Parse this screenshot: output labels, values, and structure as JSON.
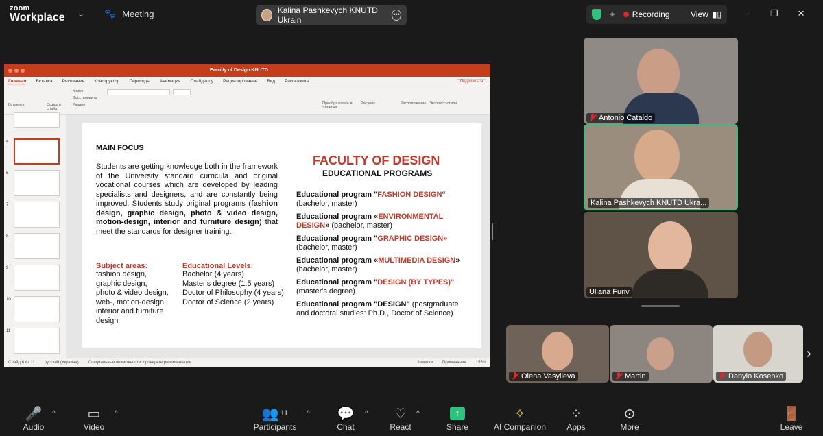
{
  "app": {
    "brand_small": "zoom",
    "brand_big": "Workplace",
    "meeting_label": "Meeting"
  },
  "share": {
    "presenter": "Kalina Pashkevych KNUTD Ukrain"
  },
  "status": {
    "recording": "Recording",
    "view": "View"
  },
  "ppt": {
    "title": "Faculty of Design KNUTD",
    "menu": [
      "Главная",
      "Вставка",
      "Рисование",
      "Конструктор",
      "Переходы",
      "Анимация",
      "Слайд-шоу",
      "Рецензирование",
      "Вид",
      "Расскажите"
    ],
    "share_btn": "Поделиться",
    "ribbon": {
      "paste": "Вставить",
      "new_slide": "Создать слайд",
      "layout": "Макет",
      "reset": "Восстановить",
      "section": "Раздел",
      "smartart": "Преобразовать в SmartArt",
      "picture": "Рисунок",
      "arrange": "Расположение",
      "styles": "Экспресс-стили"
    },
    "thumbs": [
      "5",
      "6",
      "7",
      "8",
      "9",
      "10",
      "11"
    ],
    "statusbar": {
      "slide": "Слайд 6 из 11",
      "lang": "русский (Украина)",
      "access": "Специальные возможности: проверьте рекомендации",
      "notes": "Заметки",
      "comments": "Примечания",
      "zoom": "155%"
    }
  },
  "slide": {
    "main_focus": "MAIN FOCUS",
    "para_a": "Students are getting knowledge both in the framework of the University standard curricula and original vocational courses which are developed by leading specialists and designers, and are constantly being improved. Students study original programs (",
    "para_bold": "fashion design, graphic design, photo & video design, motion-design, interior and furniture design",
    "para_b": ") that meet the standards for designer training.",
    "subject_title": "Subject areas:",
    "subjects": [
      "fashion design,",
      "graphic design,",
      "photo & video design,",
      "web-, motion-design,",
      "interior and furniture",
      "design"
    ],
    "levels_title": "Educational Levels:",
    "levels": [
      "Bachelor (4 years)",
      "Master's degree (1.5 years)",
      "Doctor of Philosophy (4 years)",
      "Doctor of Science (2 years)"
    ],
    "faculty": "FACULTY OF DESIGN",
    "edu_programs": "EDUCATIONAL PROGRAMS",
    "progs": [
      {
        "pre": "Educational program \"",
        "hl": "FASHION DESIGN",
        "post": "“",
        "note": "(bachelor, master)"
      },
      {
        "pre": "Educational program «",
        "hl": "ENVIRONMENTAL DESIGN",
        "post": "»",
        "note": " (bachelor, master)"
      },
      {
        "pre": "Educational program \"",
        "hl": "GRAPHIC DESIGN»",
        "post": "",
        "note": "(bachelor, master)"
      },
      {
        "pre": "Educational program «",
        "hl": "MULTIMEDIA DESIGN",
        "post": "»",
        "note": "(bachelor, master)"
      },
      {
        "pre": "Educational program \"",
        "hl": "DESIGN (BY TYPES)\"",
        "post": "",
        "note": "(master's degree)"
      },
      {
        "pre": "Educational program \"DESIGN\"",
        "hl": "",
        "post": " (postgraduate",
        "note": "and doctoral studies: Ph.D., Doctor of Science)"
      }
    ]
  },
  "participants": {
    "p1": "Antonio Cataldo",
    "p2": "Kalina Pashkevych KNUTD Ukra...",
    "p3": "Uliana Furiv",
    "p4": "Olena Vasylieva",
    "p5": "Martin",
    "p6": "Danylo Kosenko"
  },
  "toolbar": {
    "audio": "Audio",
    "video": "Video",
    "participants": "Participants",
    "participants_count": "11",
    "chat": "Chat",
    "react": "React",
    "share": "Share",
    "ai": "AI Companion",
    "apps": "Apps",
    "more": "More",
    "leave": "Leave"
  },
  "colors": {
    "ppt_accent": "#c43e1c",
    "share_green": "#2ec27e",
    "active_speaker": "#2ec27e",
    "mute_red": "#e02828"
  }
}
